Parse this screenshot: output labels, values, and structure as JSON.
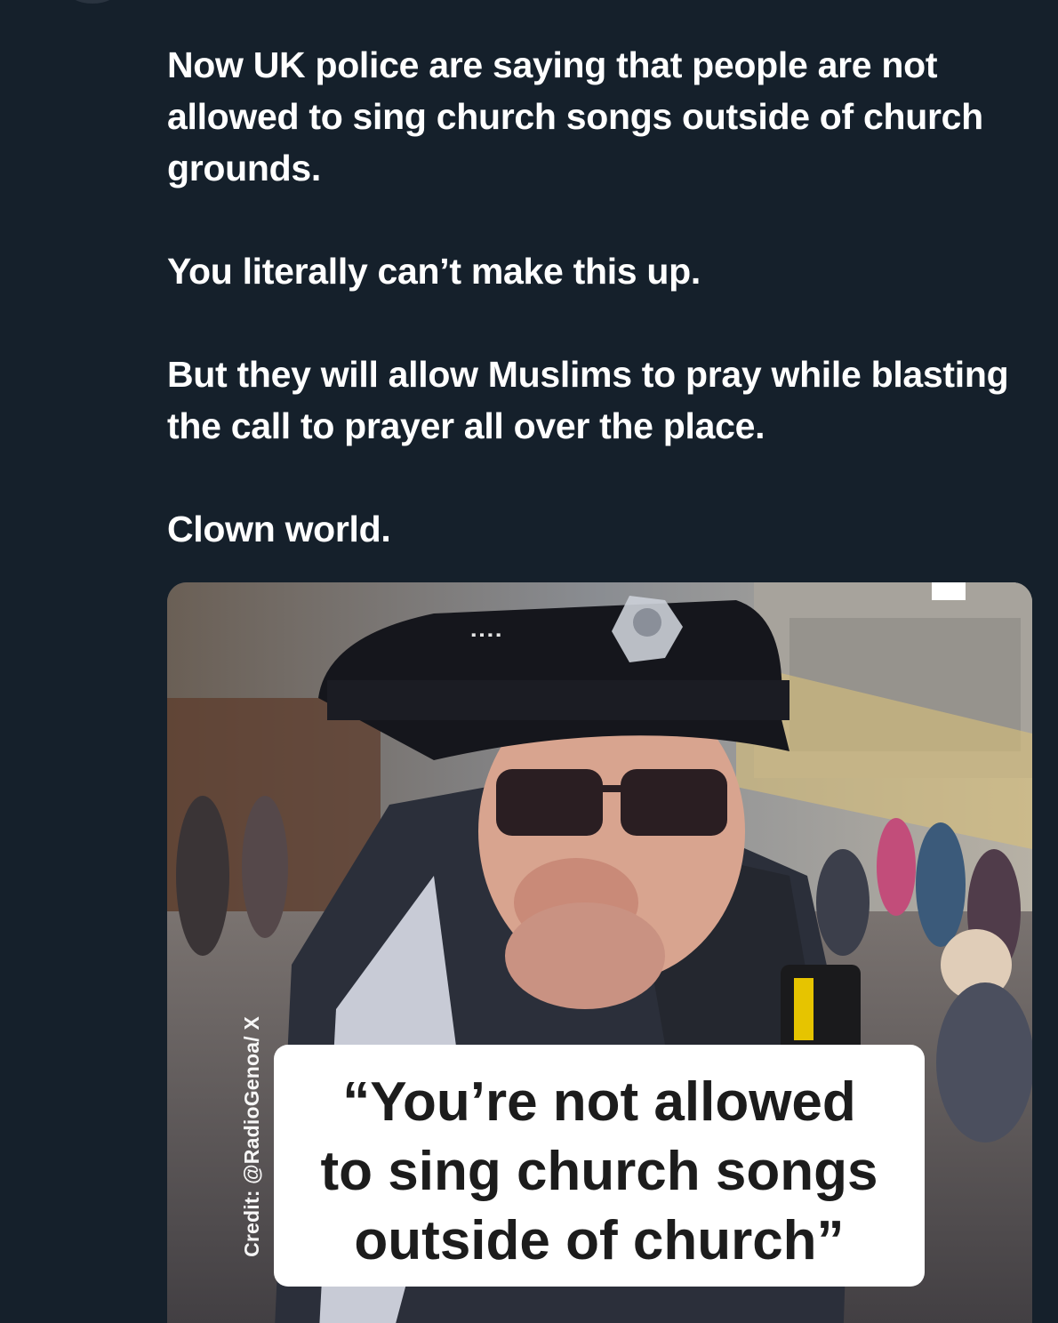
{
  "post": {
    "paragraphs": [
      "Now UK police are saying that people are not allowed to sing church songs outside of church grounds.",
      "You literally can’t make this up.",
      "But they will allow Muslims to pray while blasting the call to prayer all over the place.",
      "Clown world."
    ]
  },
  "media": {
    "credit": "Credit: @RadioGenoa/ X",
    "caption_lines": [
      "“You’re not allowed",
      "to sing church songs",
      "outside of church”"
    ]
  }
}
